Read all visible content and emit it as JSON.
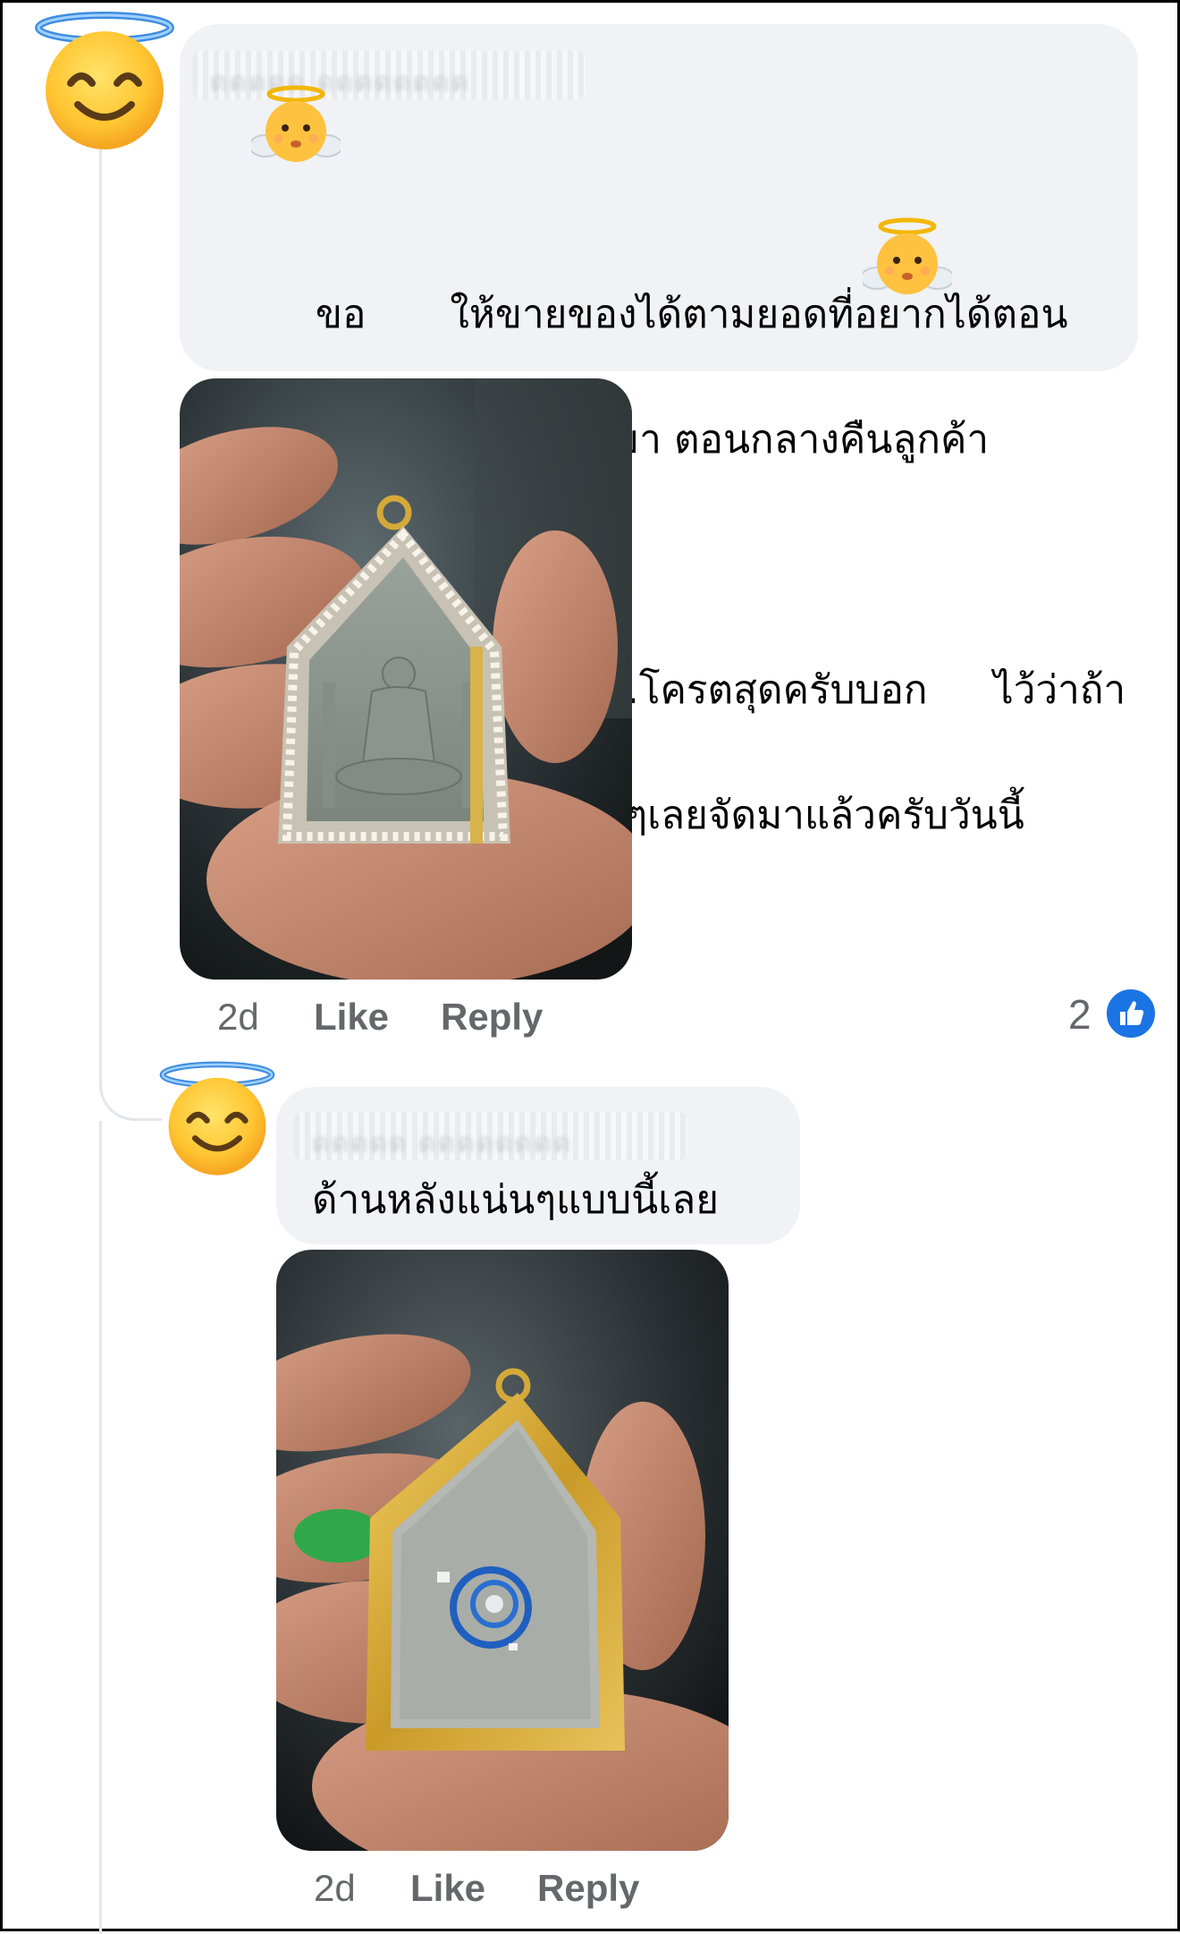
{
  "comments": [
    {
      "author_name": "ดดดดด ดดดดดดดด",
      "text_line1": "ขอ",
      "text_line1b": "ให้ขายของได้ตามยอดที่อยากได้ตอน",
      "text_line2": "เที่ยง ตอนเย็นลูกค้าโทรมา ตอนกลางคืนลูกค้า",
      "text_line3a": "มาเอา ไม่ถึง12ชม.โครตสุดครับบอก",
      "text_line3b": "ไว้ว่าถ้า",
      "text_line4": "ขายได้จะเลี่ยมกรอบสวยๆเลยจัดมาแล้วครับวันนี้",
      "time": "2d",
      "like_label": "Like",
      "reply_label": "Reply",
      "reaction_count": "2",
      "reaction_icon": "like-thumb-icon",
      "avatar_icon": "smiling-face-with-halo-icon"
    },
    {
      "author_name": "ดดดดด ดดดดดดดด",
      "text": "ด้านหลังแน่นๆแบบนี้เลย",
      "time": "2d",
      "like_label": "Like",
      "reply_label": "Reply",
      "avatar_icon": "smiling-face-with-halo-icon"
    }
  ],
  "colors": {
    "bubble": "#f0f2f5",
    "meta_text": "#65676b",
    "like_blue": "#1b74e4"
  }
}
